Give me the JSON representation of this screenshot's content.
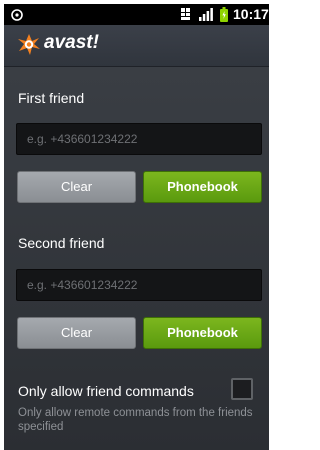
{
  "status_bar": {
    "time": "10:17",
    "icons": [
      "notification-icon",
      "sim-icon",
      "signal-icon",
      "battery-icon"
    ]
  },
  "header": {
    "app_name": "avast!",
    "logo_icon": "avast-logo-icon",
    "brand_color": "#f5811f"
  },
  "first_friend": {
    "label": "First friend",
    "placeholder": "e.g. +436601234222",
    "clear_label": "Clear",
    "phonebook_label": "Phonebook"
  },
  "second_friend": {
    "label": "Second friend",
    "placeholder": "e.g. +436601234222",
    "clear_label": "Clear",
    "phonebook_label": "Phonebook"
  },
  "friend_commands": {
    "title": "Only allow friend commands",
    "description": "Only allow remote commands from the friends specified",
    "checked": false
  },
  "colors": {
    "accent_green": "#6aa716",
    "button_gray": "#989ca1",
    "background": "#33373c"
  }
}
